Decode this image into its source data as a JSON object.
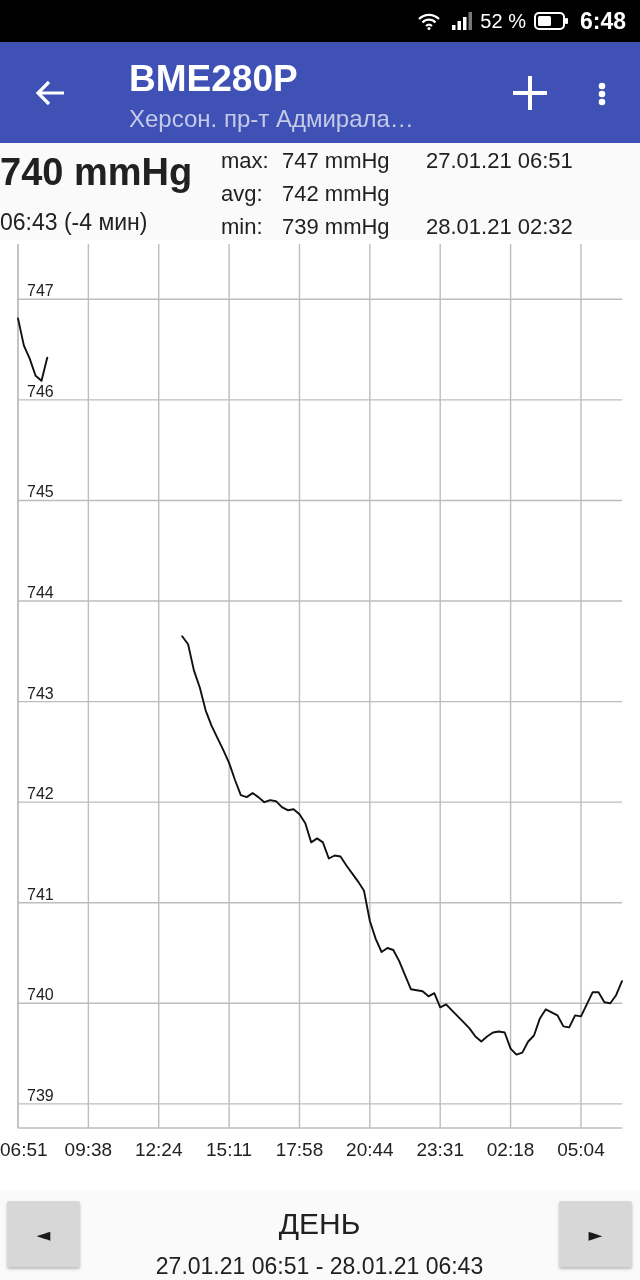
{
  "status_bar": {
    "battery": "52 %",
    "time": "6:48"
  },
  "app_bar": {
    "title": "BME280P",
    "subtitle": "Херсон. пр-т Адмирала…"
  },
  "current": {
    "value": "740 mmHg",
    "time": "06:43 (-4 мин)"
  },
  "stats": [
    {
      "label": "max:",
      "value": "747 mmHg",
      "timestamp": "27.01.21 06:51"
    },
    {
      "label": "avg:",
      "value": "742 mmHg"
    },
    {
      "label": "min:",
      "value": "739 mmHg",
      "timestamp": "28.01.21 02:32"
    }
  ],
  "chart": {
    "chart_data": {
      "type": "line",
      "grid": true,
      "categories": [
        "06:51",
        null,
        null,
        null,
        null,
        null,
        null,
        null,
        null,
        null,
        null,
        null,
        "09:38",
        null,
        null,
        null,
        null,
        null,
        null,
        null,
        null,
        null,
        null,
        null,
        "12:24",
        null,
        null,
        null,
        null,
        null,
        null,
        null,
        null,
        null,
        null,
        null,
        "15:11",
        null,
        null,
        null,
        null,
        null,
        null,
        null,
        null,
        null,
        null,
        null,
        "17:58",
        null,
        null,
        null,
        null,
        null,
        null,
        null,
        null,
        null,
        null,
        null,
        "20:44",
        null,
        null,
        null,
        null,
        null,
        null,
        null,
        null,
        null,
        null,
        null,
        "23:31",
        null,
        null,
        null,
        null,
        null,
        null,
        null,
        null,
        null,
        null,
        null,
        "02:18",
        null,
        null,
        null,
        null,
        null,
        null,
        null,
        null,
        null,
        null,
        null,
        "05:04",
        null,
        null,
        null,
        null,
        null,
        null,
        null
      ],
      "series": [
        {
          "color": "#111111",
          "values": [
            746.81,
            746.54,
            746.41,
            746.24,
            746.19,
            746.42,
            null,
            null,
            null,
            null,
            null,
            null,
            null,
            null,
            null,
            null,
            null,
            null,
            null,
            null,
            null,
            null,
            null,
            null,
            null,
            null,
            null,
            null,
            743.65,
            743.57,
            743.31,
            743.14,
            742.91,
            742.76,
            742.64,
            742.52,
            742.39,
            742.22,
            742.07,
            742.05,
            742.09,
            742.05,
            742,
            742.02,
            742.01,
            741.95,
            741.92,
            741.93,
            741.88,
            741.79,
            741.6,
            741.64,
            741.6,
            741.44,
            741.47,
            741.46,
            741.37,
            741.29,
            741.21,
            741.12,
            740.82,
            740.64,
            740.51,
            740.55,
            740.53,
            740.42,
            740.28,
            740.14,
            740.13,
            740.12,
            740.07,
            740.1,
            739.96,
            739.99,
            739.93,
            739.87,
            739.81,
            739.75,
            739.67,
            739.62,
            739.67,
            739.71,
            739.72,
            739.71,
            739.55,
            739.49,
            739.51,
            739.62,
            739.68,
            739.85,
            739.94,
            739.91,
            739.88,
            739.77,
            739.76,
            739.88,
            739.87,
            739.99,
            740.11,
            740.11,
            740.01,
            740,
            740.08,
            740.22
          ]
        }
      ],
      "ylim": [
        738.76,
        747.55
      ],
      "yticks": [
        739,
        740,
        741,
        742,
        743,
        744,
        745,
        746,
        747
      ]
    }
  },
  "period": {
    "prev": "◄",
    "label": "ДЕНЬ",
    "range": "27.01.21 06:51 - 28.01.21 06:43",
    "next": "►"
  }
}
